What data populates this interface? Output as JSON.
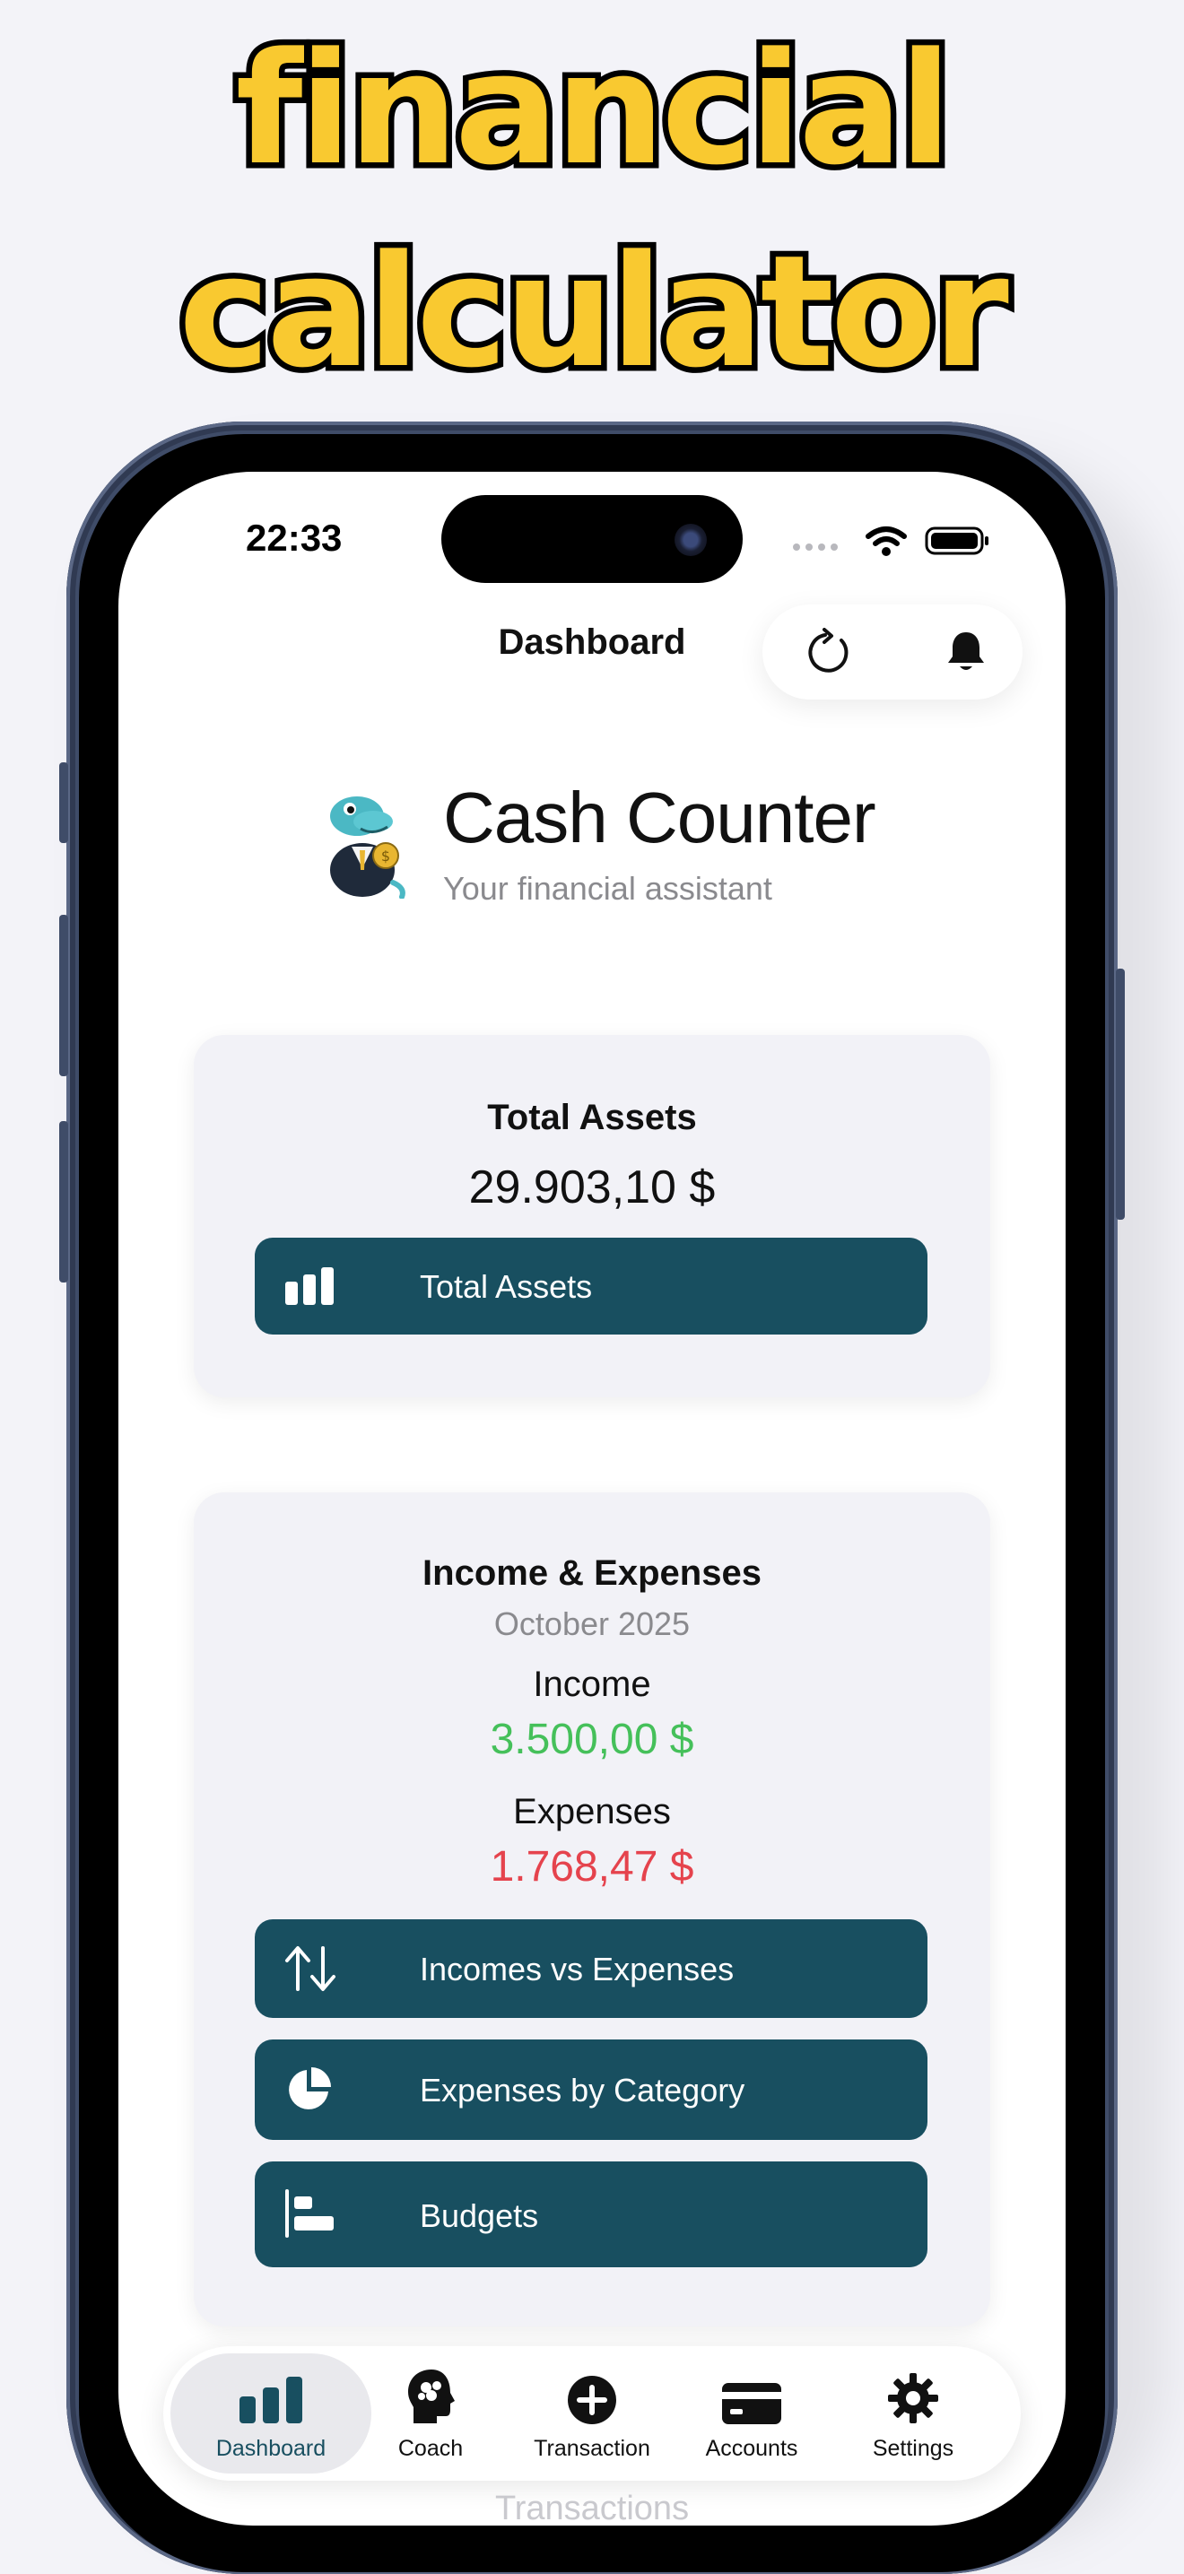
{
  "headline": {
    "line1": "financial",
    "line2": "calculator"
  },
  "status_bar": {
    "time": "22:33"
  },
  "nav": {
    "title": "Dashboard",
    "refresh_icon": "refresh-icon",
    "bell_icon": "bell-icon"
  },
  "app": {
    "name": "Cash Counter",
    "subtitle": "Your financial assistant",
    "logo_icon": "lizard-mascot-icon"
  },
  "total_assets_card": {
    "title": "Total Assets",
    "amount": "29.903,10 $",
    "button_label": "Total Assets",
    "button_icon": "bar-chart-icon"
  },
  "income_expenses_card": {
    "title": "Income & Expenses",
    "period": "October 2025",
    "income_label": "Income",
    "income_amount": "3.500,00 $",
    "expenses_label": "Expenses",
    "expenses_amount": "1.768,47 $",
    "buttons": [
      {
        "label": "Incomes vs Expenses",
        "icon": "arrows-up-down-icon"
      },
      {
        "label": "Expenses by Category",
        "icon": "pie-chart-icon"
      },
      {
        "label": "Budgets",
        "icon": "horizontal-bars-icon"
      }
    ]
  },
  "tab_bar": {
    "tabs": [
      {
        "label": "Dashboard",
        "icon": "bar-chart-icon",
        "active": true
      },
      {
        "label": "Coach",
        "icon": "brain-head-icon",
        "active": false
      },
      {
        "label": "Transaction",
        "icon": "plus-circle-icon",
        "active": false
      },
      {
        "label": "Accounts",
        "icon": "credit-card-icon",
        "active": false
      },
      {
        "label": "Settings",
        "icon": "gear-icon",
        "active": false
      }
    ]
  },
  "scroll_behind_label": "Transactions",
  "colors": {
    "brand_teal": "#184f60",
    "income_green": "#45c05a",
    "expense_red": "#e5434d",
    "headline_yellow": "#f9c930"
  }
}
